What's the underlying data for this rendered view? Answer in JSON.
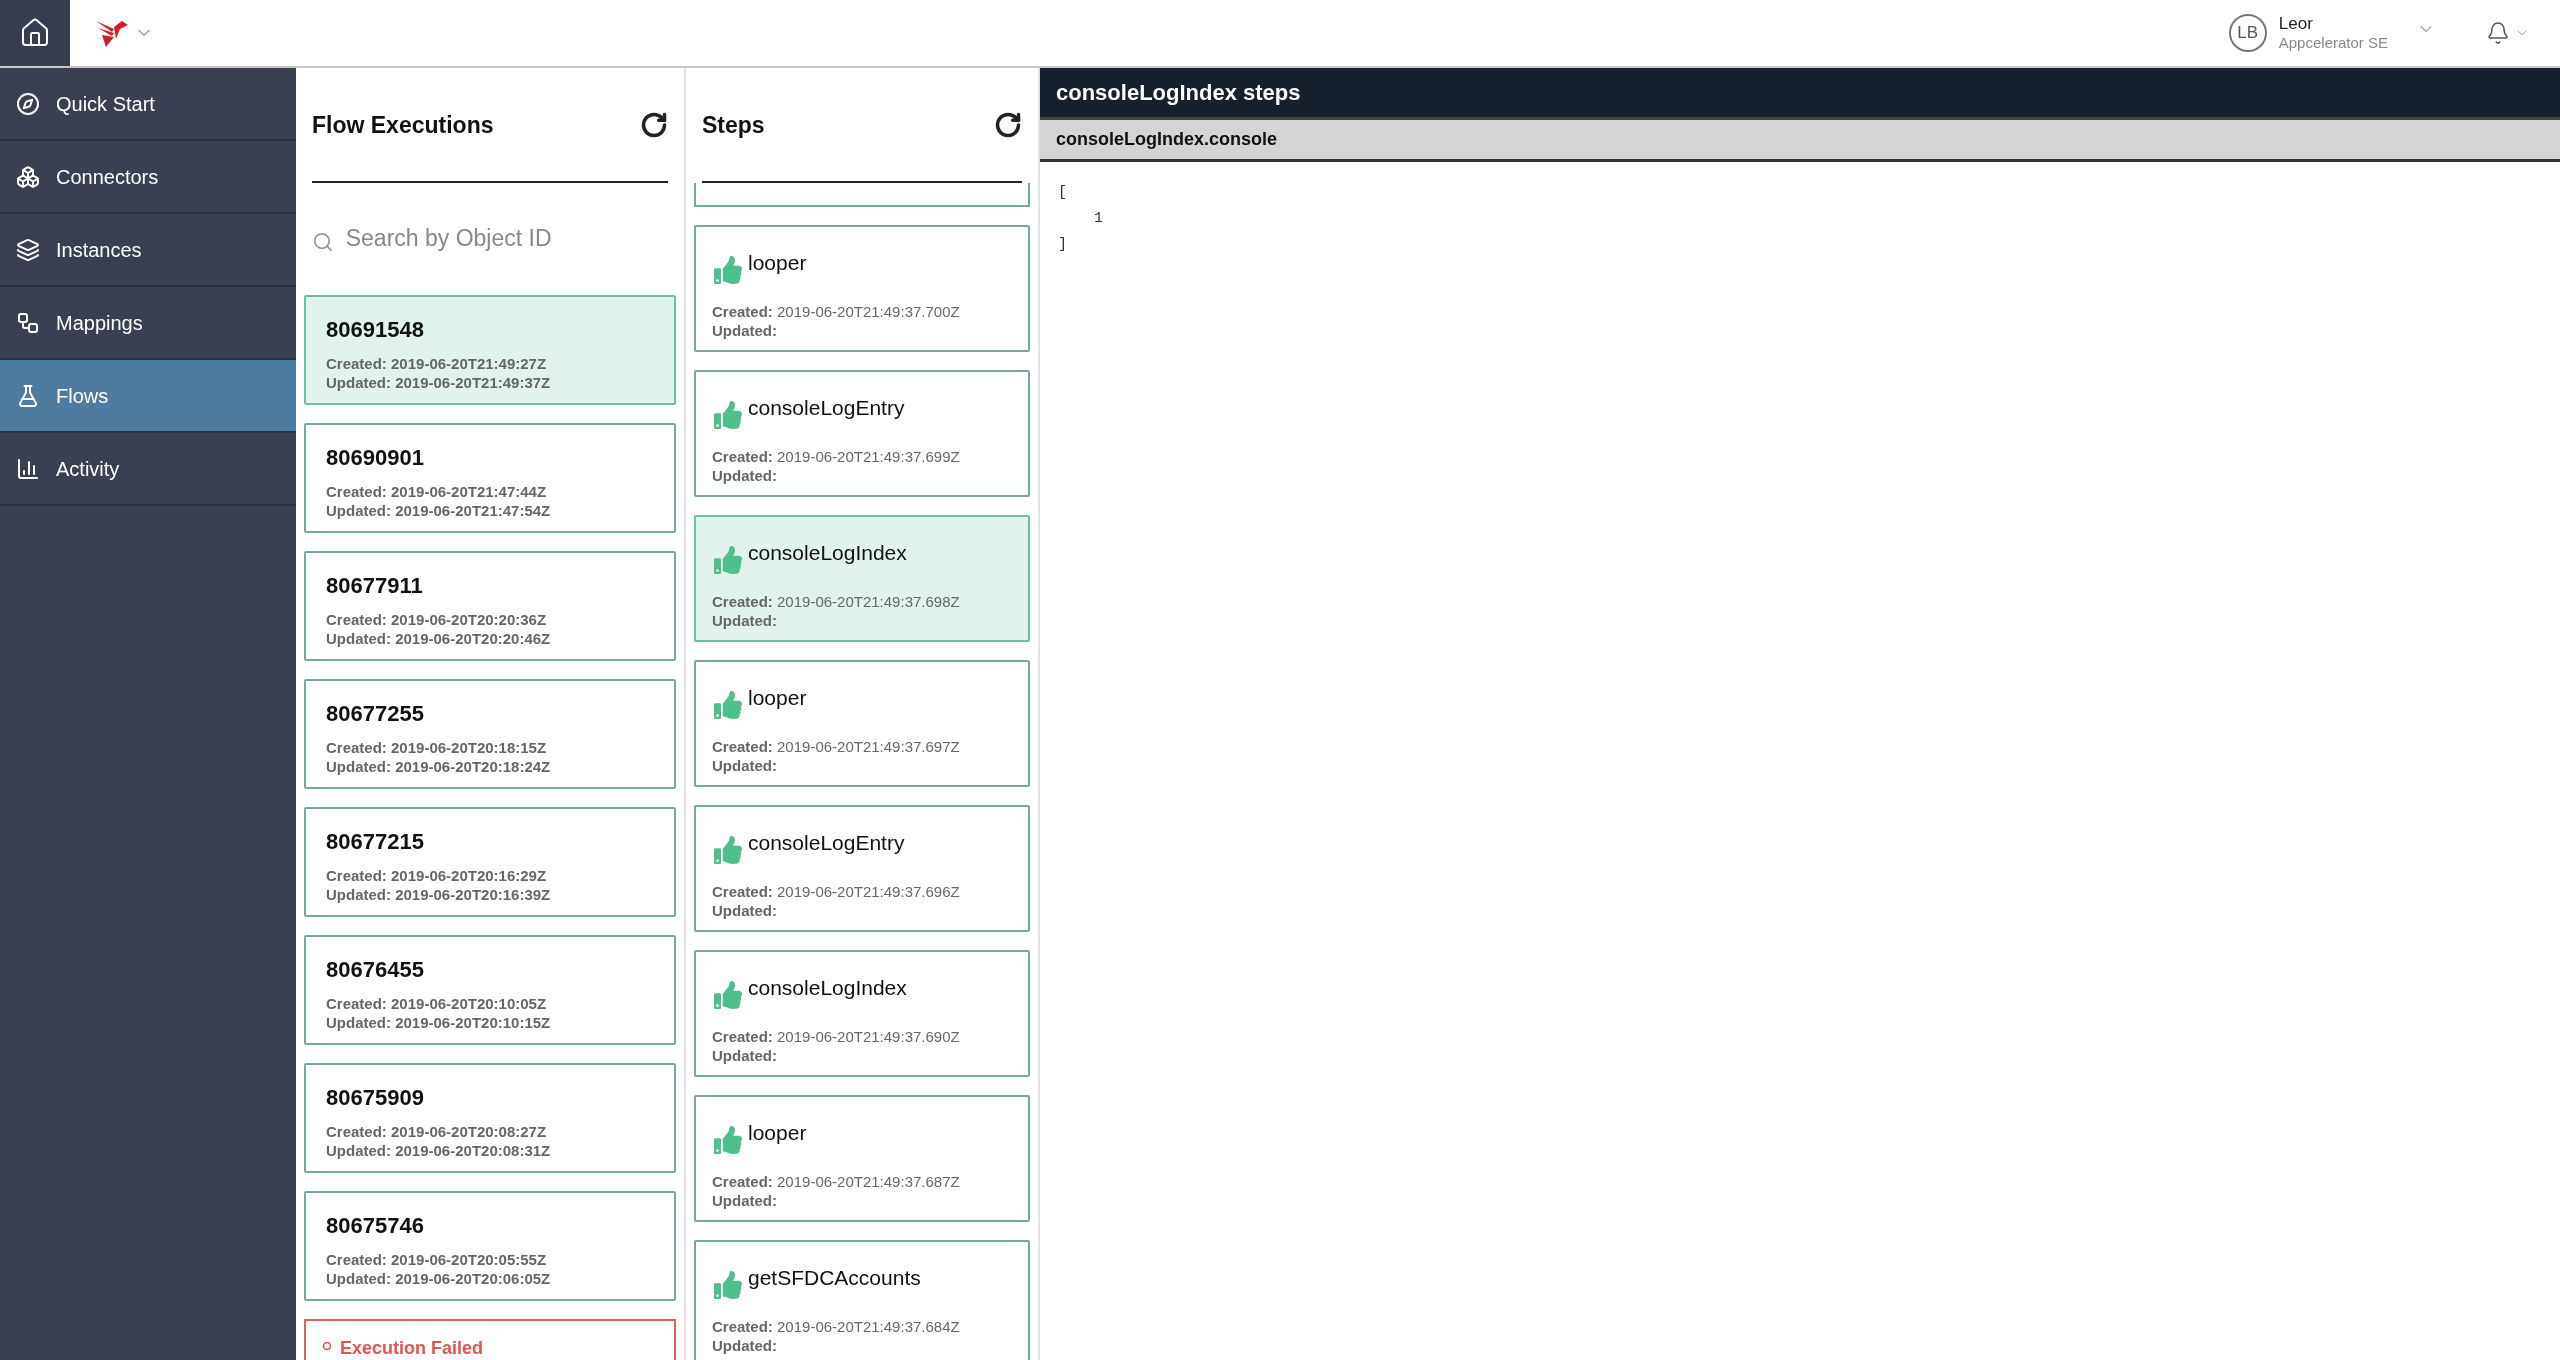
{
  "topbar": {
    "user": {
      "initials": "LB",
      "name": "Leor",
      "role": "Appcelerator SE"
    }
  },
  "sidebar": {
    "items": [
      {
        "kind": "compass",
        "label": "Quick Start",
        "selected": false
      },
      {
        "kind": "connectors",
        "label": "Connectors",
        "selected": false
      },
      {
        "kind": "instances",
        "label": "Instances",
        "selected": false
      },
      {
        "kind": "mappings",
        "label": "Mappings",
        "selected": false
      },
      {
        "kind": "flask",
        "label": "Flows",
        "selected": true
      },
      {
        "kind": "chart",
        "label": "Activity",
        "selected": false
      }
    ]
  },
  "flow_executions": {
    "title": "Flow Executions",
    "search": {
      "placeholder": "Search by Object ID"
    },
    "items": [
      {
        "id": "80691548",
        "created": "Created: 2019-06-20T21:49:27Z",
        "updated": "Updated: 2019-06-20T21:49:37Z",
        "selected": true
      },
      {
        "id": "80690901",
        "created": "Created: 2019-06-20T21:47:44Z",
        "updated": "Updated: 2019-06-20T21:47:54Z",
        "selected": false
      },
      {
        "id": "80677911",
        "created": "Created: 2019-06-20T20:20:36Z",
        "updated": "Updated: 2019-06-20T20:20:46Z",
        "selected": false
      },
      {
        "id": "80677255",
        "created": "Created: 2019-06-20T20:18:15Z",
        "updated": "Updated: 2019-06-20T20:18:24Z",
        "selected": false
      },
      {
        "id": "80677215",
        "created": "Created: 2019-06-20T20:16:29Z",
        "updated": "Updated: 2019-06-20T20:16:39Z",
        "selected": false
      },
      {
        "id": "80676455",
        "created": "Created: 2019-06-20T20:10:05Z",
        "updated": "Updated: 2019-06-20T20:10:15Z",
        "selected": false
      },
      {
        "id": "80675909",
        "created": "Created: 2019-06-20T20:08:27Z",
        "updated": "Updated: 2019-06-20T20:08:31Z",
        "selected": false
      },
      {
        "id": "80675746",
        "created": "Created: 2019-06-20T20:05:55Z",
        "updated": "Updated: 2019-06-20T20:06:05Z",
        "selected": false
      }
    ],
    "error": {
      "text": "Execution Failed"
    }
  },
  "steps": {
    "title": "Steps",
    "items": [
      {
        "name": "looper",
        "created_label": "Created:",
        "created": "2019-06-20T21:49:37.700Z",
        "updated_label": "Updated:",
        "selected": false
      },
      {
        "name": "consoleLogEntry",
        "created_label": "Created:",
        "created": "2019-06-20T21:49:37.699Z",
        "updated_label": "Updated:",
        "selected": false
      },
      {
        "name": "consoleLogIndex",
        "created_label": "Created:",
        "created": "2019-06-20T21:49:37.698Z",
        "updated_label": "Updated:",
        "selected": true
      },
      {
        "name": "looper",
        "created_label": "Created:",
        "created": "2019-06-20T21:49:37.697Z",
        "updated_label": "Updated:",
        "selected": false
      },
      {
        "name": "consoleLogEntry",
        "created_label": "Created:",
        "created": "2019-06-20T21:49:37.696Z",
        "updated_label": "Updated:",
        "selected": false
      },
      {
        "name": "consoleLogIndex",
        "created_label": "Created:",
        "created": "2019-06-20T21:49:37.690Z",
        "updated_label": "Updated:",
        "selected": false
      },
      {
        "name": "looper",
        "created_label": "Created:",
        "created": "2019-06-20T21:49:37.687Z",
        "updated_label": "Updated:",
        "selected": false
      },
      {
        "name": "getSFDCAccounts",
        "created_label": "Created:",
        "created": "2019-06-20T21:49:37.684Z",
        "updated_label": "Updated:",
        "selected": false
      }
    ]
  },
  "detail": {
    "title": "consoleLogIndex steps",
    "section": "consoleLogIndex.console",
    "code": "[\n    1\n]"
  }
}
